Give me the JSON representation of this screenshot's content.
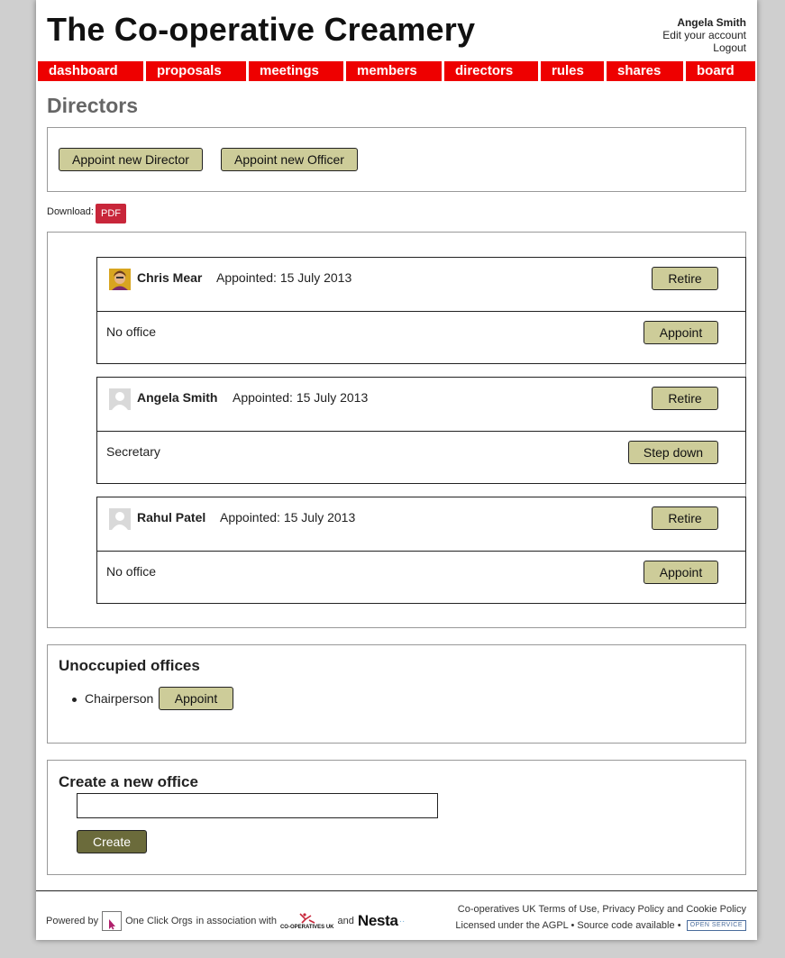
{
  "header": {
    "site_title": "The Co-operative Creamery",
    "account": {
      "user_name": "Angela Smith",
      "edit_account": "Edit your account",
      "logout": "Logout"
    }
  },
  "nav": {
    "items": [
      {
        "label": "dashboard"
      },
      {
        "label": "proposals"
      },
      {
        "label": "meetings"
      },
      {
        "label": "members"
      },
      {
        "label": "directors"
      },
      {
        "label": "rules"
      },
      {
        "label": "shares"
      },
      {
        "label": "board"
      }
    ],
    "accent_color": "#ee0000"
  },
  "page_title": "Directors",
  "actions": {
    "appoint_director": "Appoint new Director",
    "appoint_officer": "Appoint new Officer"
  },
  "download": {
    "label": "Download:",
    "pdf": "PDF"
  },
  "directors": [
    {
      "name": "Chris Mear",
      "appointed": "Appointed: 15 July 2013",
      "retire_label": "Retire",
      "office": "No office",
      "office_action": "Appoint",
      "avatar": "photo-avatar"
    },
    {
      "name": "Angela Smith",
      "appointed": "Appointed: 15 July 2013",
      "retire_label": "Retire",
      "office": "Secretary",
      "office_action": "Step down",
      "avatar": "default-avatar"
    },
    {
      "name": "Rahul Patel",
      "appointed": "Appointed: 15 July 2013",
      "retire_label": "Retire",
      "office": "No office",
      "office_action": "Appoint",
      "avatar": "default-avatar"
    }
  ],
  "unoccupied": {
    "title": "Unoccupied offices",
    "items": [
      {
        "office": "Chairperson",
        "action": "Appoint"
      }
    ]
  },
  "create_office": {
    "title": "Create a new office",
    "input_value": "",
    "submit": "Create"
  },
  "footer": {
    "powered_by": "Powered by",
    "oco_logo_text": "ONE CLICK ORGS",
    "oco": "One Click Orgs",
    "assoc": "in association with",
    "coop_logo": "CO-OPERATIVES UK",
    "and": "and",
    "nesta": "Nesta",
    "coops_uk": "Co-operatives UK",
    "terms": "Terms of Use",
    "privacy": "Privacy Policy",
    "and2": "and",
    "cookie": "Cookie Policy",
    "licensed": "Licensed under the AGPL",
    "source": "Source code available",
    "open_service": "OPEN SERVICE"
  }
}
